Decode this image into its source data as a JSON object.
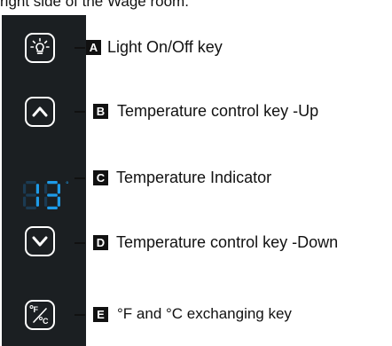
{
  "caption": "right side of the Wage room.",
  "display": {
    "reading": "13",
    "unit": "°",
    "digit_color": "#1e9be8",
    "dim_color": "#1b3a52"
  },
  "keys": [
    {
      "letter": "A",
      "label": "Light On/Off key",
      "icon": "light-bulb-icon"
    },
    {
      "letter": "B",
      "label": "Temperature control key -Up",
      "icon": "chevron-up-icon"
    },
    {
      "letter": "C",
      "label": "Temperature Indicator",
      "icon": "seven-segment-display"
    },
    {
      "letter": "D",
      "label": "Temperature control key -Down",
      "icon": "chevron-down-icon"
    },
    {
      "letter": "E",
      "label": "°F and °C  exchanging key",
      "icon": "fahrenheit-celsius-icon"
    }
  ],
  "colors": {
    "panel": "#1b1f22",
    "key_border": "#ffffff",
    "letter_box": "#111111"
  }
}
